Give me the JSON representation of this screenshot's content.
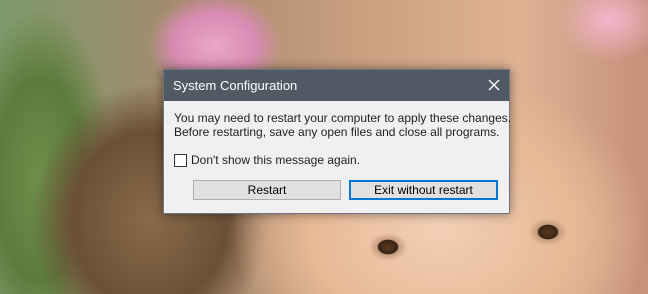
{
  "dialog": {
    "title": "System Configuration",
    "message_line1": "You may need to restart your computer to apply these changes.",
    "message_line2": "Before restarting, save any open files and close all programs.",
    "checkbox_label": "Don't show this message again.",
    "checkbox_checked": false,
    "restart_label": "Restart",
    "exit_label": "Exit without restart",
    "close_icon": "close-icon"
  },
  "colors": {
    "titlebar": "#505a64",
    "dialog_bg": "#f0f0f0",
    "default_button_border": "#0078d7"
  }
}
